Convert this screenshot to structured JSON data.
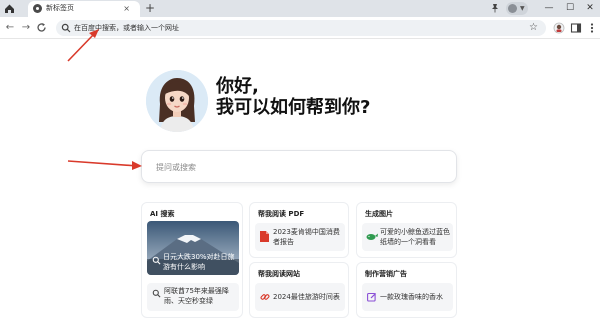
{
  "browser": {
    "tab_title": "新标签页",
    "tab_close": "×",
    "new_tab": "+",
    "window_controls": {
      "minimize": "—",
      "maximize": "☐",
      "close": "✕"
    },
    "nav": {
      "back": "←",
      "forward": "→",
      "reload": "C"
    },
    "omnibox_placeholder": "在百度中搜索，或者输入一个网址",
    "star": "☆",
    "icons": [
      "home-icon",
      "pin-icon",
      "profile-icon",
      "extension-icon",
      "sidebar-icon",
      "menu-icon"
    ]
  },
  "greeting": {
    "line1": "你好,",
    "line2": "我可以如何帮到你?"
  },
  "ask": {
    "placeholder": "提问或搜索"
  },
  "cards": {
    "ai_search": {
      "title": "AI 搜索",
      "hero_text": "日元大跌30%对赴日旅游有什么影响",
      "item_text": "阿联酋75年来最强降雨、天空秒变绿"
    },
    "read_pdf": {
      "title": "帮我阅读 PDF",
      "item_text": "2023麦肯锡中国消费者报告"
    },
    "gen_image": {
      "title": "生成图片",
      "item_text": "可爱的小鲸鱼透过蓝色纸墙的一个洞看看"
    },
    "read_web": {
      "title": "帮我阅读网站",
      "item_text": "2024最佳旅游时间表"
    },
    "marketing": {
      "title": "制作营销广告",
      "item_text": "一款玫瑰香味的香水"
    }
  },
  "colors": {
    "tab_strip": "#dfe3e8",
    "omnibox": "#eef1f4",
    "arrow": "#d93a2b",
    "pdf_red": "#d93a2b",
    "marketing_purple": "#8a4fd6",
    "image_green": "#2e9a4f"
  }
}
